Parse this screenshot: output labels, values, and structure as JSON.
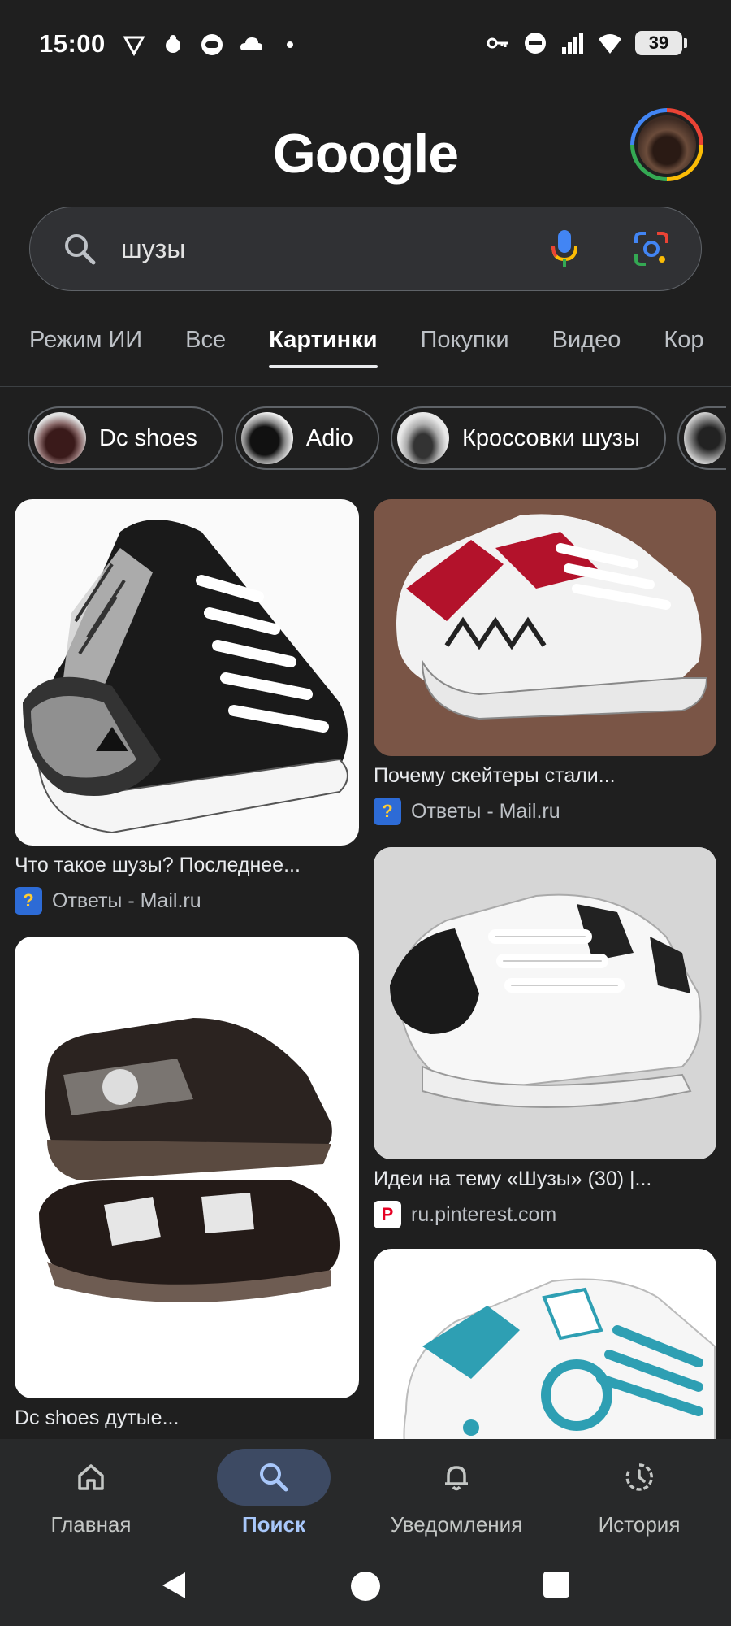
{
  "status_bar": {
    "time": "15:00",
    "battery": "39",
    "left_icons": [
      "vpn-icon",
      "bug-icon",
      "record-icon",
      "cloud-icon",
      "dot-icon"
    ],
    "right_icons": [
      "key-icon",
      "dnd-icon",
      "signal-icon",
      "wifi-icon",
      "battery-icon"
    ]
  },
  "header": {
    "logo": "Google"
  },
  "search": {
    "query": "шузы"
  },
  "tabs": [
    "Режим ИИ",
    "Все",
    "Картинки",
    "Покупки",
    "Видео",
    "Кор"
  ],
  "active_tab": "Картинки",
  "chips": [
    "Dc shoes",
    "Adio",
    "Кроссовки шузы"
  ],
  "results": [
    {
      "caption": "Что такое шузы? Последнее...",
      "source": "Ответы - Mail.ru",
      "source_icon": "?"
    },
    {
      "caption": "Почему скейтеры стали...",
      "source": "Ответы - Mail.ru",
      "source_icon": "?"
    },
    {
      "caption": "Идеи на тему «Шузы» (30) |...",
      "source": "ru.pinterest.com",
      "source_icon": "P"
    },
    {
      "caption": "Dc shoes дутые...",
      "source": "",
      "source_icon": ""
    },
    {
      "caption": "",
      "source": "",
      "source_icon": ""
    }
  ],
  "bottom_nav": [
    {
      "label": "Главная",
      "icon": "home-icon"
    },
    {
      "label": "Поиск",
      "icon": "search-icon"
    },
    {
      "label": "Уведомления",
      "icon": "bell-icon"
    },
    {
      "label": "История",
      "icon": "history-icon"
    }
  ],
  "colors": {
    "background": "#1f1f1f",
    "search_bg": "#303134",
    "nav_active": "#a8c7fa",
    "nav_pill": "#3d4a63"
  }
}
